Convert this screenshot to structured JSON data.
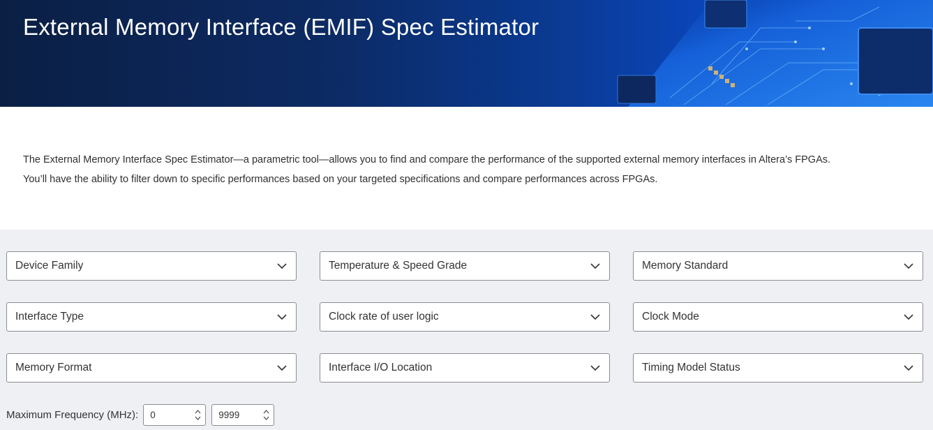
{
  "header": {
    "title": "External Memory Interface (EMIF) Spec Estimator"
  },
  "intro": {
    "line1": "The External Memory Interface Spec Estimator—a parametric tool—allows you to find and compare the performance of the supported external memory interfaces in Altera’s FPGAs.",
    "line2": "You’ll have the ability to filter down to specific performances based on your targeted specifications and compare performances across FPGAs."
  },
  "filters": {
    "dropdowns": [
      {
        "label": "Device Family"
      },
      {
        "label": "Temperature & Speed Grade"
      },
      {
        "label": "Memory Standard"
      },
      {
        "label": "Interface Type"
      },
      {
        "label": "Clock rate of user logic"
      },
      {
        "label": "Clock Mode"
      },
      {
        "label": "Memory Format"
      },
      {
        "label": "Interface I/O Location"
      },
      {
        "label": "Timing Model Status"
      }
    ],
    "max_frequency": {
      "label": "Maximum Frequency (MHz):",
      "min_value": "0",
      "max_value": "9999"
    }
  },
  "icons": {
    "dropdown": "chevron-down-icon",
    "stepper_up": "chevron-up-icon",
    "stepper_down": "chevron-down-icon"
  },
  "colors": {
    "hero_dark": "#0b1f44",
    "hero_light": "#0c58d6",
    "filter_bg": "#eef0f4",
    "border": "#8a8d93"
  }
}
